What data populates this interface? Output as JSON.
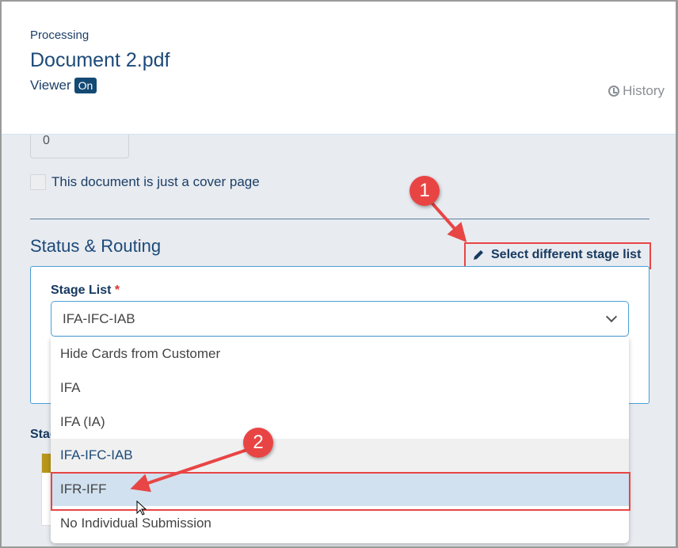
{
  "header": {
    "status": "Processing",
    "title": "Document 2.pdf",
    "viewer_label": "Viewer",
    "viewer_state": "On",
    "history_label": "History"
  },
  "form": {
    "number_value": "0",
    "cover_page_label": "This document is just a cover page",
    "cover_page_checked": false
  },
  "status_routing": {
    "title": "Status & Routing",
    "select_link": "Select different stage list",
    "stage_list_label": "Stage List",
    "required_mark": "*",
    "stage_list_value": "IFA-IFC-IAB",
    "stage_label_partial": "Stag"
  },
  "dropdown": {
    "options": [
      "Hide Cards from Customer",
      "IFA",
      "IFA (IA)",
      "IFA-IFC-IAB",
      "IFR-IFF",
      "No Individual Submission"
    ],
    "selected": "IFA-IFC-IAB",
    "hovered": "IFR-IFF"
  },
  "annotations": {
    "step1": "1",
    "step2": "2",
    "color": "#e84545"
  }
}
